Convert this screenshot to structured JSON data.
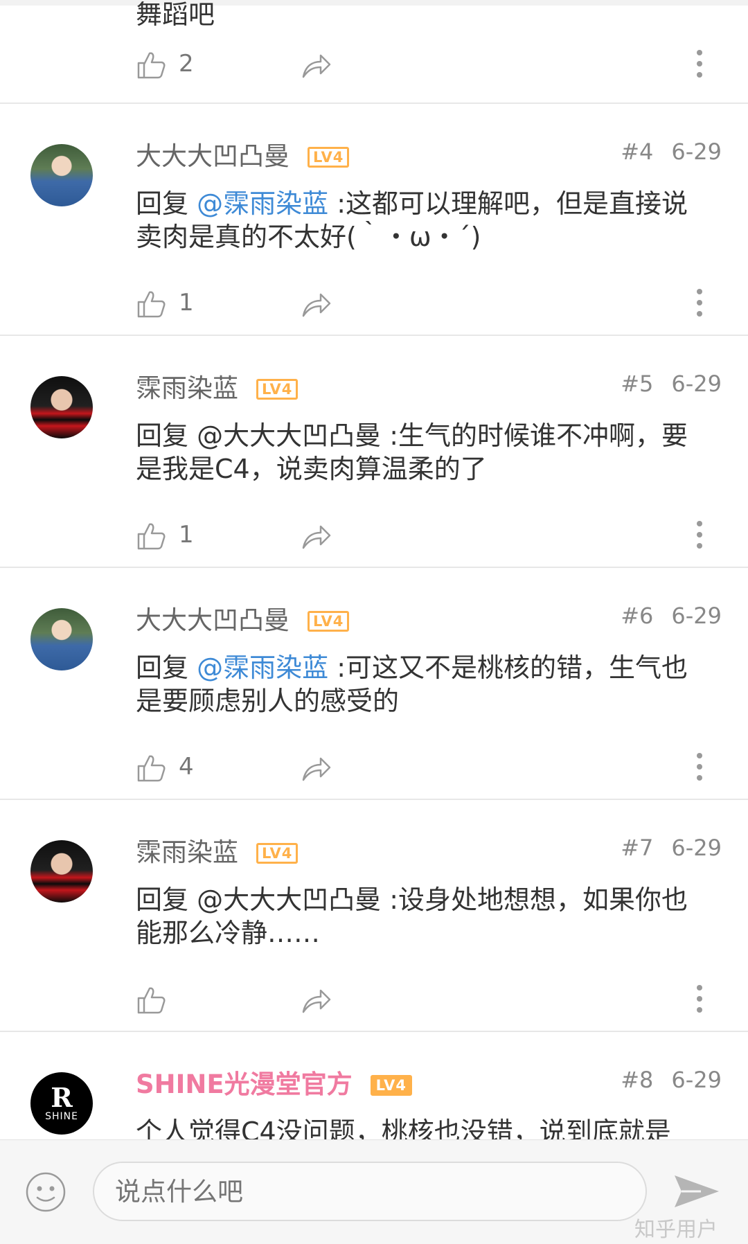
{
  "partial_comment": {
    "text_tail": "舞蹈吧",
    "like_count": "2"
  },
  "comments": [
    {
      "username": "大大大凹凸曼",
      "level": "LV4",
      "floor": "#4",
      "date": "6-29",
      "reply_prefix": "回复 ",
      "mention": "@霂雨染蓝",
      "text": " :这都可以理解吧，但是直接说卖肉是真的不太好(｀・ω・´)",
      "like_count": "1"
    },
    {
      "username": "霂雨染蓝",
      "level": "LV4",
      "floor": "#5",
      "date": "6-29",
      "reply_prefix": "回复 ",
      "mention": "@大大大凹凸曼",
      "text": " :生气的时候谁不冲啊，要是我是C4，说卖肉算温柔的了",
      "like_count": "1"
    },
    {
      "username": "大大大凹凸曼",
      "level": "LV4",
      "floor": "#6",
      "date": "6-29",
      "reply_prefix": "回复 ",
      "mention": "@霂雨染蓝",
      "text": " :可这又不是桃核的错，生气也是要顾虑别人的感受的",
      "like_count": "4"
    },
    {
      "username": "霂雨染蓝",
      "level": "LV4",
      "floor": "#7",
      "date": "6-29",
      "reply_prefix": "回复 ",
      "mention": "@大大大凹凸曼",
      "text": " :设身处地想想，如果你也能那么冷静……",
      "like_count": ""
    },
    {
      "username": "SHINE光漫堂官方",
      "level": "LV4",
      "floor": "#8",
      "date": "6-29",
      "text": "个人觉得C4没问题，桃核也没错，说到底就是"
    }
  ],
  "avatar_text": {
    "letter": "R",
    "brand": "SHINE"
  },
  "input": {
    "placeholder": "说点什么吧"
  },
  "watermark": "知乎用户",
  "colors": {
    "mention": "#3e8ad6",
    "level_badge": "#ffb14a",
    "official_name": "#f07aa0"
  },
  "icons": [
    "like-icon",
    "share-icon",
    "more-icon",
    "emoji-icon",
    "send-icon"
  ]
}
